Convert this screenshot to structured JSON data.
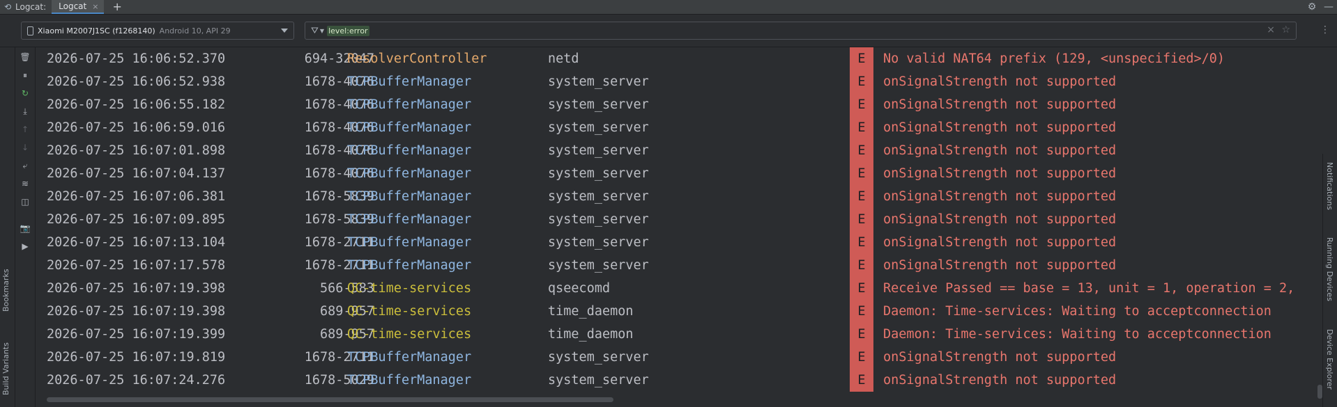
{
  "tabbar": {
    "tool_window_title": "Logcat:",
    "active_tab": "Logcat",
    "close_glyph": "×",
    "add_glyph": "+",
    "settings_glyph": "⚙",
    "minimize_glyph": "—"
  },
  "toolbar": {
    "device_name": "Xiaomi M2007J1SC (f1268140)",
    "device_api": "Android 10, API 29",
    "filter_value": "level:error",
    "filter_placeholder": "",
    "clear_glyph": "×",
    "favorite_glyph": "☆",
    "more_glyph": "⋮"
  },
  "side_panels": {
    "left": [
      "Bookmarks",
      "Build Variants"
    ],
    "right": [
      "Notifications",
      "Running Devices",
      "Device Explorer"
    ]
  },
  "actions": [
    {
      "name": "clear-logcat-icon",
      "glyph": "🗑"
    },
    {
      "name": "pause-icon",
      "glyph": "⏸"
    },
    {
      "name": "restart-icon",
      "glyph": "↻"
    },
    {
      "name": "scroll-to-end-icon",
      "glyph": "⤓"
    },
    {
      "name": "previous-occurrence-icon",
      "glyph": "↑"
    },
    {
      "name": "next-occurrence-icon",
      "glyph": "↓"
    },
    {
      "name": "soft-wrap-icon",
      "glyph": "⤶"
    },
    {
      "name": "format-icon",
      "glyph": "≋"
    },
    {
      "name": "split-panels-icon",
      "glyph": "◫"
    },
    {
      "name": "screenshot-icon",
      "glyph": "📷"
    },
    {
      "name": "screen-record-icon",
      "glyph": "▶"
    }
  ],
  "colors": {
    "error_badge": "#cf5b56",
    "error_text": "#e8766d",
    "tag_resolver": "#e5a96b",
    "tag_tcp": "#8fb6e0",
    "tag_qc": "#cbbe3b",
    "filter_highlight": "#39523c"
  },
  "log_rows": [
    {
      "timestamp": "2026-07-25 16:06:52.370",
      "pid_tid": "694-32047",
      "tag": "ResolverController",
      "tag_class": "tag-resolver",
      "process": "netd",
      "level": "E",
      "message": "No valid NAT64 prefix (129, <unspecified>/0)"
    },
    {
      "timestamp": "2026-07-25 16:06:52.938",
      "pid_tid": "1678-4076",
      "tag": "TCPBufferManager",
      "tag_class": "tag-tcp",
      "process": "system_server",
      "level": "E",
      "message": "onSignalStrength not supported"
    },
    {
      "timestamp": "2026-07-25 16:06:55.182",
      "pid_tid": "1678-4076",
      "tag": "TCPBufferManager",
      "tag_class": "tag-tcp",
      "process": "system_server",
      "level": "E",
      "message": "onSignalStrength not supported"
    },
    {
      "timestamp": "2026-07-25 16:06:59.016",
      "pid_tid": "1678-4076",
      "tag": "TCPBufferManager",
      "tag_class": "tag-tcp",
      "process": "system_server",
      "level": "E",
      "message": "onSignalStrength not supported"
    },
    {
      "timestamp": "2026-07-25 16:07:01.898",
      "pid_tid": "1678-4076",
      "tag": "TCPBufferManager",
      "tag_class": "tag-tcp",
      "process": "system_server",
      "level": "E",
      "message": "onSignalStrength not supported"
    },
    {
      "timestamp": "2026-07-25 16:07:04.137",
      "pid_tid": "1678-4076",
      "tag": "TCPBufferManager",
      "tag_class": "tag-tcp",
      "process": "system_server",
      "level": "E",
      "message": "onSignalStrength not supported"
    },
    {
      "timestamp": "2026-07-25 16:07:06.381",
      "pid_tid": "1678-5839",
      "tag": "TCPBufferManager",
      "tag_class": "tag-tcp",
      "process": "system_server",
      "level": "E",
      "message": "onSignalStrength not supported"
    },
    {
      "timestamp": "2026-07-25 16:07:09.895",
      "pid_tid": "1678-5839",
      "tag": "TCPBufferManager",
      "tag_class": "tag-tcp",
      "process": "system_server",
      "level": "E",
      "message": "onSignalStrength not supported"
    },
    {
      "timestamp": "2026-07-25 16:07:13.104",
      "pid_tid": "1678-2711",
      "tag": "TCPBufferManager",
      "tag_class": "tag-tcp",
      "process": "system_server",
      "level": "E",
      "message": "onSignalStrength not supported"
    },
    {
      "timestamp": "2026-07-25 16:07:17.578",
      "pid_tid": "1678-2711",
      "tag": "TCPBufferManager",
      "tag_class": "tag-tcp",
      "process": "system_server",
      "level": "E",
      "message": "onSignalStrength not supported"
    },
    {
      "timestamp": "2026-07-25 16:07:19.398",
      "pid_tid": "566-583",
      "tag": "QC-time-services",
      "tag_class": "tag-qc",
      "process": "qseecomd",
      "level": "E",
      "message": "Receive Passed == base = 13, unit = 1, operation = 2,"
    },
    {
      "timestamp": "2026-07-25 16:07:19.398",
      "pid_tid": "689-957",
      "tag": "QC-time-services",
      "tag_class": "tag-qc",
      "process": "time_daemon",
      "level": "E",
      "message": "Daemon: Time-services: Waiting to acceptconnection"
    },
    {
      "timestamp": "2026-07-25 16:07:19.399",
      "pid_tid": "689-957",
      "tag": "QC-time-services",
      "tag_class": "tag-qc",
      "process": "time_daemon",
      "level": "E",
      "message": "Daemon: Time-services: Waiting to acceptconnection"
    },
    {
      "timestamp": "2026-07-25 16:07:19.819",
      "pid_tid": "1678-2711",
      "tag": "TCPBufferManager",
      "tag_class": "tag-tcp",
      "process": "system_server",
      "level": "E",
      "message": "onSignalStrength not supported"
    },
    {
      "timestamp": "2026-07-25 16:07:24.276",
      "pid_tid": "1678-5029",
      "tag": "TCPBufferManager",
      "tag_class": "tag-tcp",
      "process": "system_server",
      "level": "E",
      "message": "onSignalStrength not supported"
    }
  ]
}
